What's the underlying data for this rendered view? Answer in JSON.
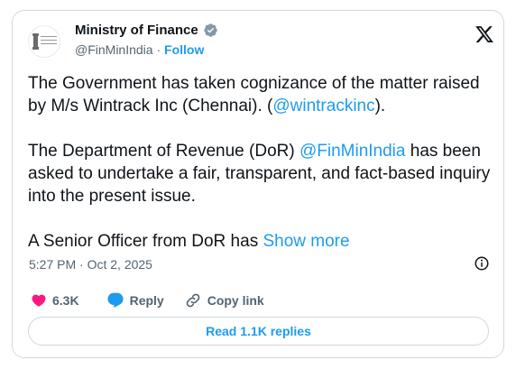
{
  "account": {
    "name": "Ministry of Finance",
    "handle": "@FinMinIndia",
    "follow_label": "Follow",
    "separator": "·",
    "avatar_text": "वित्त मंत्रालय MINISTRY OF FINANCE"
  },
  "tweet": {
    "p1_text": "The Government has taken cognizance of the matter raised by M/s Wintrack Inc (Chennai). (",
    "p1_mention": "@wintrackinc",
    "p1_end": ").",
    "p2_text": "The Department of Revenue (DoR) ",
    "p2_mention": "@FinMinIndia",
    "p2_end": " has been asked to undertake a fair, transparent, and fact-based inquiry into the present issue.",
    "p3_text": "A Senior Officer from DoR has ",
    "show_more": "Show more"
  },
  "meta": {
    "time": "5:27 PM",
    "separator": "·",
    "date": "Oct 2, 2025"
  },
  "actions": {
    "likes": "6.3K",
    "reply": "Reply",
    "copy_link": "Copy link"
  },
  "read_replies": "Read 1.1K replies",
  "colors": {
    "accent": "#1d9bf0",
    "like": "#f91880",
    "text": "#0f1419",
    "muted": "#536471"
  },
  "icons": [
    "emblem-avatar",
    "verified-badge-icon",
    "x-logo-icon",
    "info-icon",
    "heart-icon",
    "reply-icon",
    "link-icon"
  ]
}
